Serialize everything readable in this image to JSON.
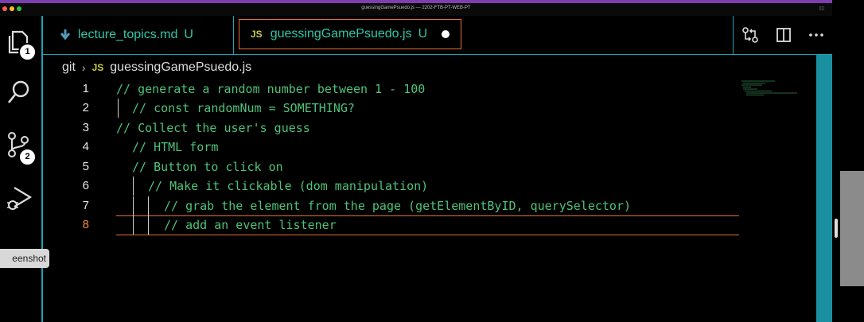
{
  "window": {
    "title": "guessingGamePsuedo.js — 2202-FTB-PT-WEB-PT"
  },
  "activity_bar": {
    "explorer_badge": "1",
    "scm_badge": "2"
  },
  "tooltip": {
    "text": "eenshot"
  },
  "tabs": [
    {
      "label": "lecture_topics.md",
      "status": "U",
      "icon": "markdown-icon"
    },
    {
      "label": "guessingGamePsuedo.js",
      "status": "U",
      "icon_text": "JS",
      "active": true,
      "unsaved": true
    }
  ],
  "breadcrumb": {
    "folder": "git",
    "separator": "›",
    "icon_text": "JS",
    "file": "guessingGamePsuedo.js"
  },
  "editor": {
    "active_line": 8,
    "lines": [
      {
        "num": "1",
        "text": "// generate a random number between 1 - 100"
      },
      {
        "num": "2",
        "text": "// const randomNum = SOMETHING?"
      },
      {
        "num": "3",
        "text": "// Collect the user's guess"
      },
      {
        "num": "4",
        "text": "// HTML form"
      },
      {
        "num": "5",
        "text": "// Button to click on"
      },
      {
        "num": "6",
        "text": "// Make it clickable (dom manipulation)"
      },
      {
        "num": "7",
        "text": "// grab the element from the page (getElementByID, querySelector)"
      },
      {
        "num": "8",
        "text": "// add an event listener"
      }
    ]
  },
  "colors": {
    "accent": "#1aa4b8",
    "comment": "#4ec27a",
    "active_border": "#e0703a",
    "title_accent": "#7b3fb0"
  }
}
